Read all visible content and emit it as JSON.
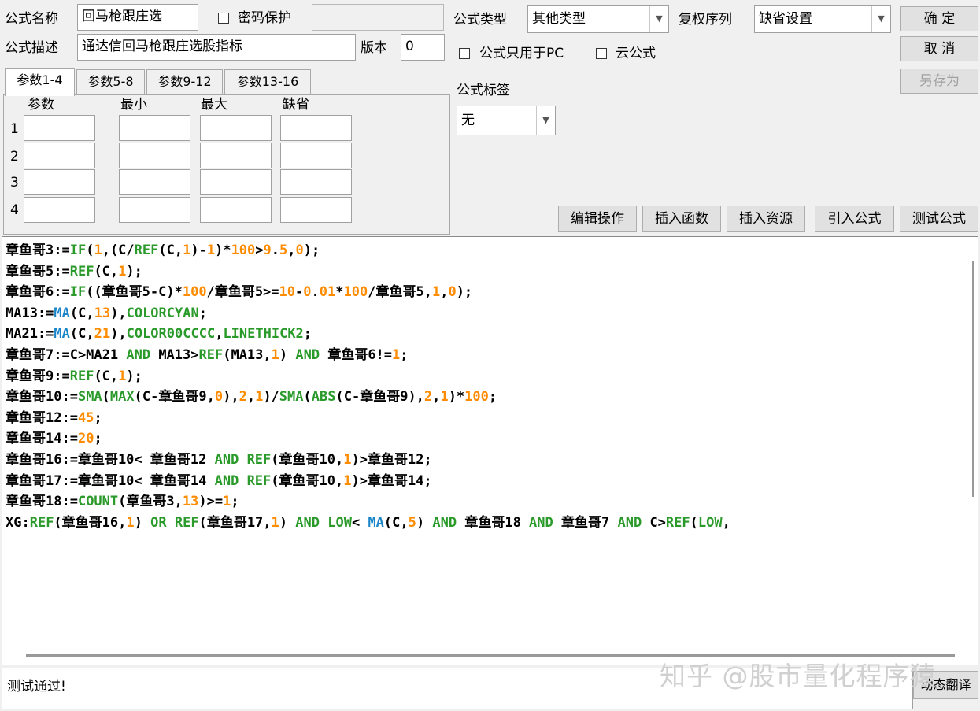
{
  "form": {
    "name_label": "公式名称",
    "name_value": "回马枪跟庄选",
    "password_label": "密码保护",
    "desc_label": "公式描述",
    "desc_value": "通达信回马枪跟庄选股指标",
    "version_label": "版本",
    "version_value": "0",
    "type_label": "公式类型",
    "type_value": "其他类型",
    "rights_label": "复权序列",
    "rights_value": "缺省设置",
    "pc_only_label": "公式只用于PC",
    "cloud_label": "云公式",
    "tag_label": "公式标签",
    "tag_value": "无"
  },
  "buttons": {
    "ok": "确 定",
    "cancel": "取 消",
    "save_as": "另存为",
    "edit_ops": "编辑操作",
    "insert_func": "插入函数",
    "insert_resource": "插入资源",
    "import_formula": "引入公式",
    "test_formula": "测试公式",
    "dynamic_translate": "动态翻译"
  },
  "tabs": [
    "参数1-4",
    "参数5-8",
    "参数9-12",
    "参数13-16"
  ],
  "params": {
    "headers": [
      "参数",
      "最小",
      "最大",
      "缺省"
    ],
    "rows": [
      "1",
      "2",
      "3",
      "4"
    ]
  },
  "code_lines": [
    [
      [
        "章鱼哥3:=",
        "w"
      ],
      [
        "IF",
        "f"
      ],
      [
        "(",
        "w"
      ],
      [
        "1",
        "o"
      ],
      [
        ",(C/",
        "w"
      ],
      [
        "REF",
        "f"
      ],
      [
        "(C,",
        "w"
      ],
      [
        "1",
        "o"
      ],
      [
        ")-",
        "w"
      ],
      [
        "1",
        "o"
      ],
      [
        ")*",
        "w"
      ],
      [
        "100",
        "o"
      ],
      [
        ">",
        "w"
      ],
      [
        "9",
        "o"
      ],
      [
        ".",
        "w"
      ],
      [
        "5",
        "o"
      ],
      [
        ",",
        "w"
      ],
      [
        "0",
        "o"
      ],
      [
        ");",
        "w"
      ]
    ],
    [
      [
        "章鱼哥5:=",
        "w"
      ],
      [
        "REF",
        "f"
      ],
      [
        "(C,",
        "w"
      ],
      [
        "1",
        "o"
      ],
      [
        ");",
        "w"
      ]
    ],
    [
      [
        "章鱼哥6:=",
        "w"
      ],
      [
        "IF",
        "f"
      ],
      [
        "((章鱼哥5-C)*",
        "w"
      ],
      [
        "100",
        "o"
      ],
      [
        "/章鱼哥5>=",
        "w"
      ],
      [
        "10",
        "o"
      ],
      [
        "-",
        "w"
      ],
      [
        "0",
        "o"
      ],
      [
        ".",
        "w"
      ],
      [
        "01",
        "o"
      ],
      [
        "*",
        "w"
      ],
      [
        "100",
        "o"
      ],
      [
        "/章鱼哥5,",
        "w"
      ],
      [
        "1",
        "o"
      ],
      [
        ",",
        "w"
      ],
      [
        "0",
        "o"
      ],
      [
        ");",
        "w"
      ]
    ],
    [
      [
        "MA13:=",
        "w"
      ],
      [
        "MA",
        "b"
      ],
      [
        "(C,",
        "w"
      ],
      [
        "13",
        "o"
      ],
      [
        "),",
        "w"
      ],
      [
        "COLORCYAN",
        "f"
      ],
      [
        ";",
        "w"
      ]
    ],
    [
      [
        "MA21:=",
        "w"
      ],
      [
        "MA",
        "b"
      ],
      [
        "(C,",
        "w"
      ],
      [
        "21",
        "o"
      ],
      [
        "),",
        "w"
      ],
      [
        "COLOR00CCCC",
        "f"
      ],
      [
        ",",
        "w"
      ],
      [
        "LINETHICK2",
        "f"
      ],
      [
        ";",
        "w"
      ]
    ],
    [
      [
        "章鱼哥7:=C>MA21 ",
        "w"
      ],
      [
        "AND",
        "f"
      ],
      [
        " MA13>",
        "w"
      ],
      [
        "REF",
        "f"
      ],
      [
        "(MA13,",
        "w"
      ],
      [
        "1",
        "o"
      ],
      [
        ") ",
        "w"
      ],
      [
        "AND",
        "f"
      ],
      [
        " 章鱼哥6!=",
        "w"
      ],
      [
        "1",
        "o"
      ],
      [
        ";",
        "w"
      ]
    ],
    [
      [
        "章鱼哥9:=",
        "w"
      ],
      [
        "REF",
        "f"
      ],
      [
        "(C,",
        "w"
      ],
      [
        "1",
        "o"
      ],
      [
        ");",
        "w"
      ]
    ],
    [
      [
        "章鱼哥10:=",
        "w"
      ],
      [
        "SMA",
        "f"
      ],
      [
        "(",
        "w"
      ],
      [
        "MAX",
        "f"
      ],
      [
        "(C-章鱼哥9,",
        "w"
      ],
      [
        "0",
        "o"
      ],
      [
        "),",
        "w"
      ],
      [
        "2",
        "o"
      ],
      [
        ",",
        "w"
      ],
      [
        "1",
        "o"
      ],
      [
        ")/",
        "w"
      ],
      [
        "SMA",
        "f"
      ],
      [
        "(",
        "w"
      ],
      [
        "ABS",
        "f"
      ],
      [
        "(C-章鱼哥9),",
        "w"
      ],
      [
        "2",
        "o"
      ],
      [
        ",",
        "w"
      ],
      [
        "1",
        "o"
      ],
      [
        ")*",
        "w"
      ],
      [
        "100",
        "o"
      ],
      [
        ";",
        "w"
      ]
    ],
    [
      [
        "章鱼哥12:=",
        "w"
      ],
      [
        "45",
        "o"
      ],
      [
        ";",
        "w"
      ]
    ],
    [
      [
        "章鱼哥14:=",
        "w"
      ],
      [
        "20",
        "o"
      ],
      [
        ";",
        "w"
      ]
    ],
    [
      [
        "章鱼哥16:=章鱼哥10< 章鱼哥12 ",
        "w"
      ],
      [
        "AND",
        "f"
      ],
      [
        " ",
        "w"
      ],
      [
        "REF",
        "f"
      ],
      [
        "(章鱼哥10,",
        "w"
      ],
      [
        "1",
        "o"
      ],
      [
        ")>章鱼哥12;",
        "w"
      ]
    ],
    [
      [
        "章鱼哥17:=章鱼哥10< 章鱼哥14 ",
        "w"
      ],
      [
        "AND",
        "f"
      ],
      [
        " ",
        "w"
      ],
      [
        "REF",
        "f"
      ],
      [
        "(章鱼哥10,",
        "w"
      ],
      [
        "1",
        "o"
      ],
      [
        ")>章鱼哥14;",
        "w"
      ]
    ],
    [
      [
        "章鱼哥18:=",
        "w"
      ],
      [
        "COUNT",
        "f"
      ],
      [
        "(章鱼哥3,",
        "w"
      ],
      [
        "13",
        "o"
      ],
      [
        ")>=",
        "w"
      ],
      [
        "1",
        "o"
      ],
      [
        ";",
        "w"
      ]
    ],
    [
      [
        "XG:",
        "w"
      ],
      [
        "REF",
        "f"
      ],
      [
        "(章鱼哥16,",
        "w"
      ],
      [
        "1",
        "o"
      ],
      [
        ") ",
        "w"
      ],
      [
        "OR",
        "f"
      ],
      [
        " ",
        "w"
      ],
      [
        "REF",
        "f"
      ],
      [
        "(章鱼哥17,",
        "w"
      ],
      [
        "1",
        "o"
      ],
      [
        ") ",
        "w"
      ],
      [
        "AND",
        "f"
      ],
      [
        " ",
        "w"
      ],
      [
        "LOW",
        "f"
      ],
      [
        "< ",
        "w"
      ],
      [
        "MA",
        "b"
      ],
      [
        "(C,",
        "w"
      ],
      [
        "5",
        "o"
      ],
      [
        ") ",
        "w"
      ],
      [
        "AND",
        "f"
      ],
      [
        " 章鱼哥18 ",
        "w"
      ],
      [
        "AND",
        "f"
      ],
      [
        " 章鱼哥7 ",
        "w"
      ],
      [
        "AND",
        "f"
      ],
      [
        " C>",
        "w"
      ],
      [
        "REF",
        "f"
      ],
      [
        "(",
        "w"
      ],
      [
        "LOW",
        "f"
      ],
      [
        ",",
        "w"
      ]
    ]
  ],
  "status": "测试通过!",
  "watermark": "知乎 @股市量化程序猿",
  "colors": {
    "keyword": "#2a9a2a",
    "ma_func": "#1a86c8",
    "number": "#ff8c00",
    "text": "#000000"
  }
}
